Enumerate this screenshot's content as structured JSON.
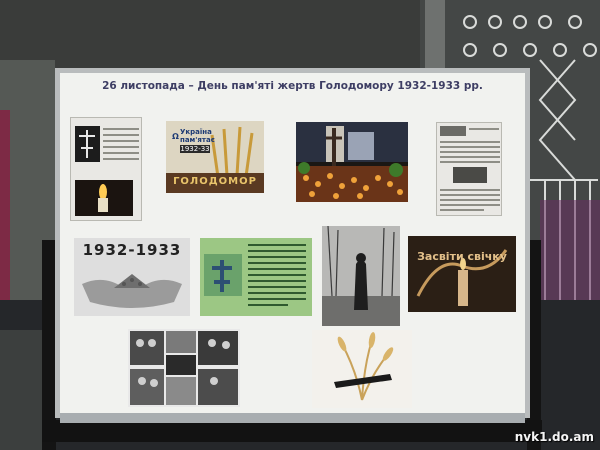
{
  "board": {
    "heading": "26 листопада – День пам'яті  жертв Голодомору  1932-1933 рр."
  },
  "posters": {
    "ukraine_title": "Україна пам'ятає",
    "ukraine_years": "1932-33",
    "holodomor_word": "ГОЛОДОМОР",
    "years_banner": "1932-1933",
    "candle_caption": "Засвіти свічку"
  },
  "watermark": "nvk1.do.am",
  "colors": {
    "heading": "#3e3e64",
    "board": "#f1f2ef",
    "frame": "#b9bcbd",
    "poster_wheat": "#c89a3a",
    "poster_dark": "#2b1f15"
  }
}
